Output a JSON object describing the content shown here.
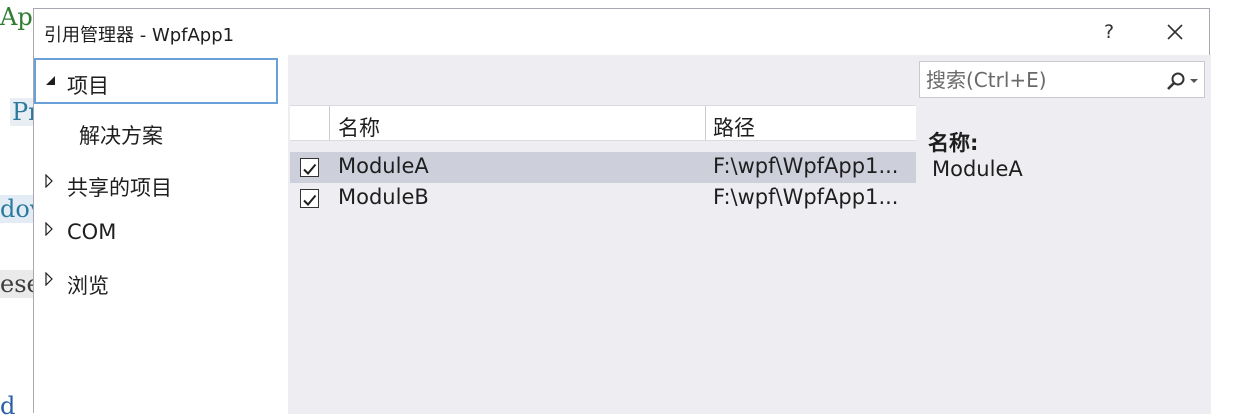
{
  "background": {
    "fragments": [
      "App",
      "Pr",
      "dov",
      "ese",
      "d"
    ]
  },
  "window": {
    "title": "引用管理器 - WpfApp1",
    "help_label": "?"
  },
  "nav": {
    "items": [
      {
        "label": "项目",
        "state": "expanded-selected"
      },
      {
        "label": "解决方案",
        "state": "child"
      },
      {
        "label": "共享的项目",
        "state": "collapsed"
      },
      {
        "label": "COM",
        "state": "collapsed"
      },
      {
        "label": "浏览",
        "state": "collapsed"
      }
    ]
  },
  "list": {
    "columns": {
      "name": "名称",
      "path": "路径"
    },
    "rows": [
      {
        "checked": true,
        "name": "ModuleA",
        "path": "F:\\wpf\\WpfApp1...",
        "selected": true
      },
      {
        "checked": true,
        "name": "ModuleB",
        "path": "F:\\wpf\\WpfApp1...",
        "selected": false
      }
    ]
  },
  "search": {
    "placeholder": "搜索(Ctrl+E)",
    "value": ""
  },
  "detail": {
    "name_label": "名称:",
    "name_value": "ModuleA"
  },
  "colors": {
    "selection_row": "#cdcfdb",
    "focus_border": "#6aa0d8",
    "panel_bg": "#eeeef2"
  }
}
